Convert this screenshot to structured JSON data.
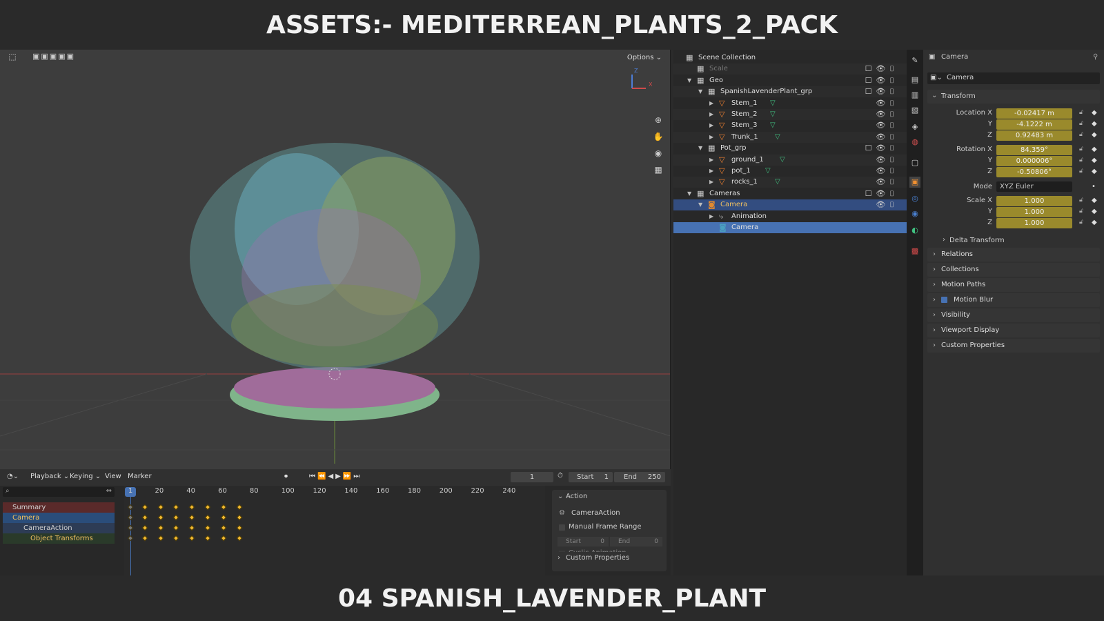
{
  "banner_top": "ASSETS:- MEDITERREAN_PLANTS_2_PACK",
  "banner_bottom": "04 SPANISH_LAVENDER_PLANT",
  "viewport": {
    "options": "Options ⌄",
    "axis_z": "Z",
    "axis_x": "X"
  },
  "outliner": {
    "rows": [
      {
        "label": "Scene Collection",
        "indent": 0,
        "kind": "collection"
      },
      {
        "label": "Scale",
        "indent": 1,
        "kind": "collection",
        "dim": true
      },
      {
        "label": "Geo",
        "indent": 1,
        "kind": "collection"
      },
      {
        "label": "SpanishLavenderPlant_grp",
        "indent": 2,
        "kind": "collection"
      },
      {
        "label": "Stem_1",
        "indent": 3,
        "kind": "mesh"
      },
      {
        "label": "Stem_2",
        "indent": 3,
        "kind": "mesh"
      },
      {
        "label": "Stem_3",
        "indent": 3,
        "kind": "mesh"
      },
      {
        "label": "Trunk_1",
        "indent": 3,
        "kind": "mesh"
      },
      {
        "label": "Pot_grp",
        "indent": 2,
        "kind": "collection"
      },
      {
        "label": "ground_1",
        "indent": 3,
        "kind": "mesh"
      },
      {
        "label": "pot_1",
        "indent": 3,
        "kind": "mesh"
      },
      {
        "label": "rocks_1",
        "indent": 3,
        "kind": "mesh"
      },
      {
        "label": "Cameras",
        "indent": 1,
        "kind": "collection"
      },
      {
        "label": "Camera",
        "indent": 2,
        "kind": "camera",
        "selected": true
      },
      {
        "label": "Animation",
        "indent": 3,
        "kind": "anim"
      },
      {
        "label": "Camera",
        "indent": 3,
        "kind": "cameradata",
        "active": true
      }
    ]
  },
  "properties": {
    "header": "Camera",
    "object_name": "Camera",
    "transform_label": "Transform",
    "location": {
      "label_x": "Location X",
      "x": "-0.02417 m",
      "y": "-4.1222 m",
      "z": "0.92483 m"
    },
    "rotation": {
      "label_x": "Rotation X",
      "x": "84.359°",
      "y": "0.000006°",
      "z": "-0.50806°"
    },
    "mode_label": "Mode",
    "mode": "XYZ Euler",
    "scale": {
      "label_x": "Scale X",
      "x": "1.000",
      "y": "1.000",
      "z": "1.000"
    },
    "axis_y": "Y",
    "axis_z": "Z",
    "delta": "Delta Transform",
    "panels": [
      "Relations",
      "Collections",
      "Motion Paths",
      "Motion Blur",
      "Visibility",
      "Viewport Display",
      "Custom Properties"
    ]
  },
  "timeline": {
    "playback": "Playback ⌄",
    "keying": "Keying ⌄",
    "view": "View",
    "marker": "Marker",
    "current_frame": "1",
    "start_label": "Start",
    "start": "1",
    "end_label": "End",
    "end": "250",
    "frame_marker": "1",
    "frame_ticks": [
      "20",
      "40",
      "60",
      "80",
      "100",
      "120",
      "140",
      "160",
      "180",
      "200",
      "220",
      "240"
    ],
    "channels": [
      {
        "label": "Summary"
      },
      {
        "label": "Camera"
      },
      {
        "label": "CameraAction"
      },
      {
        "label": "Object Transforms"
      }
    ],
    "keyframes": [
      1,
      10,
      20,
      30,
      40,
      50,
      60,
      70
    ]
  },
  "action_panel": {
    "title": "Action",
    "action_name": "CameraAction",
    "manual": "Manual Frame Range",
    "start_label": "Start",
    "start": "0",
    "end_label": "End",
    "end": "0",
    "cyclic": "Cyclic Animation",
    "custom": "Custom Properties"
  }
}
